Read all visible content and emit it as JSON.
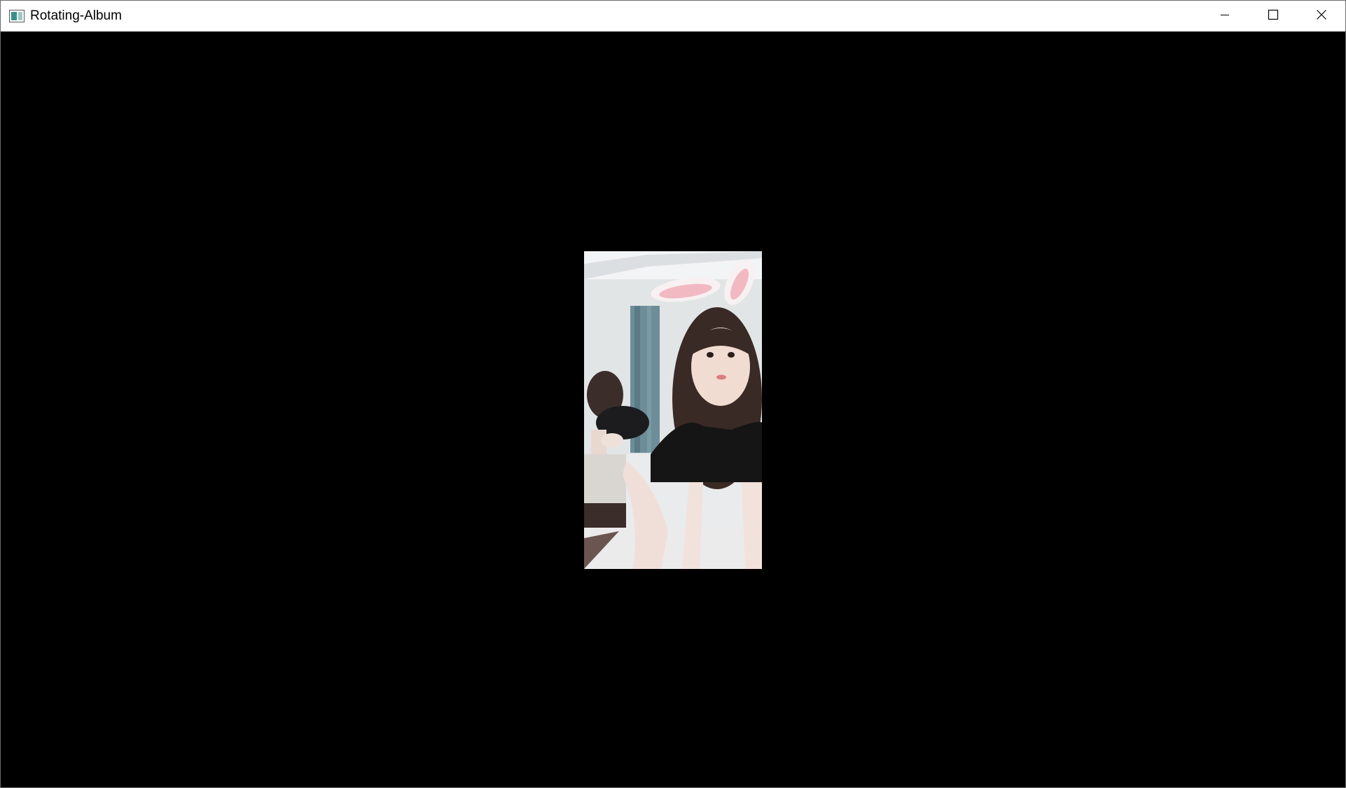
{
  "window": {
    "title": "Rotating-Album",
    "icon": "app-window-icon",
    "controls": {
      "minimize_icon": "minimize-icon",
      "maximize_icon": "maximize-icon",
      "close_icon": "close-icon"
    }
  },
  "album": {
    "background": "#000000",
    "current_photo": {
      "orientation": "portrait"
    }
  }
}
